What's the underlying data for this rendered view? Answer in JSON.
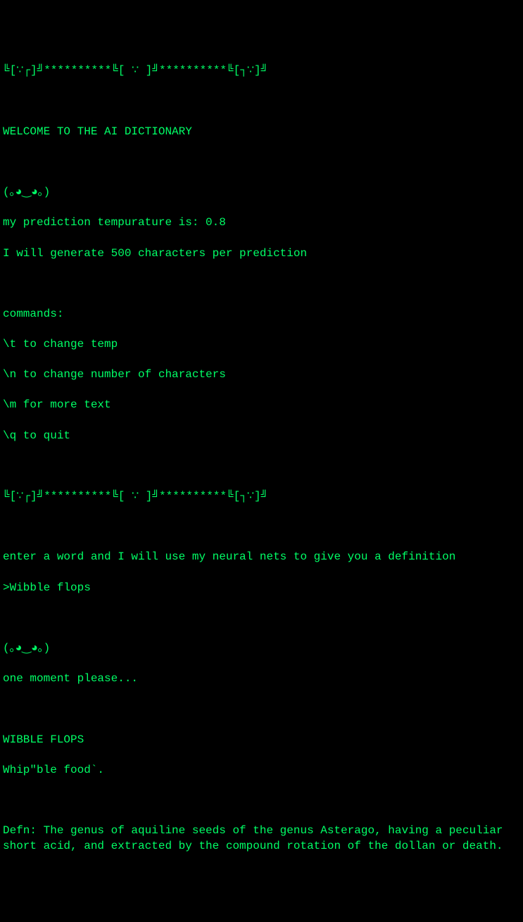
{
  "banner": "╚[∵┌]╝**********╚[ ∵ ]╝**********╚[┐∵]╝",
  "welcome": "WELCOME TO THE AI DICTIONARY",
  "face": "(｡◕‿◕｡)",
  "temp_line": "my prediction tempurature is: 0.8",
  "chars_line": "I will generate 500 characters per prediction",
  "commands_header": "commands:",
  "cmd_t": "\\t to change temp",
  "cmd_n": "\\n to change number of characters",
  "cmd_m": "\\m for more text",
  "cmd_q": "\\q to quit",
  "banner2": "╚[∵┌]╝**********╚[ ∵ ]╝**********╚[┐∵]╝",
  "prompt_instruction": "enter a word and I will use my neural nets to give you a definition",
  "user_input": ">Wibble flops",
  "face2": "(｡◕‿◕｡)",
  "wait_msg": "one moment please...",
  "result_header": "WIBBLE FLOPS",
  "result_sub": "Whip\"ble food`.",
  "defn": "Defn: The genus of aquiline seeds of the genus Asterago, having a peculiar short acid, and extracted by the compound rotation of the dollan or death."
}
